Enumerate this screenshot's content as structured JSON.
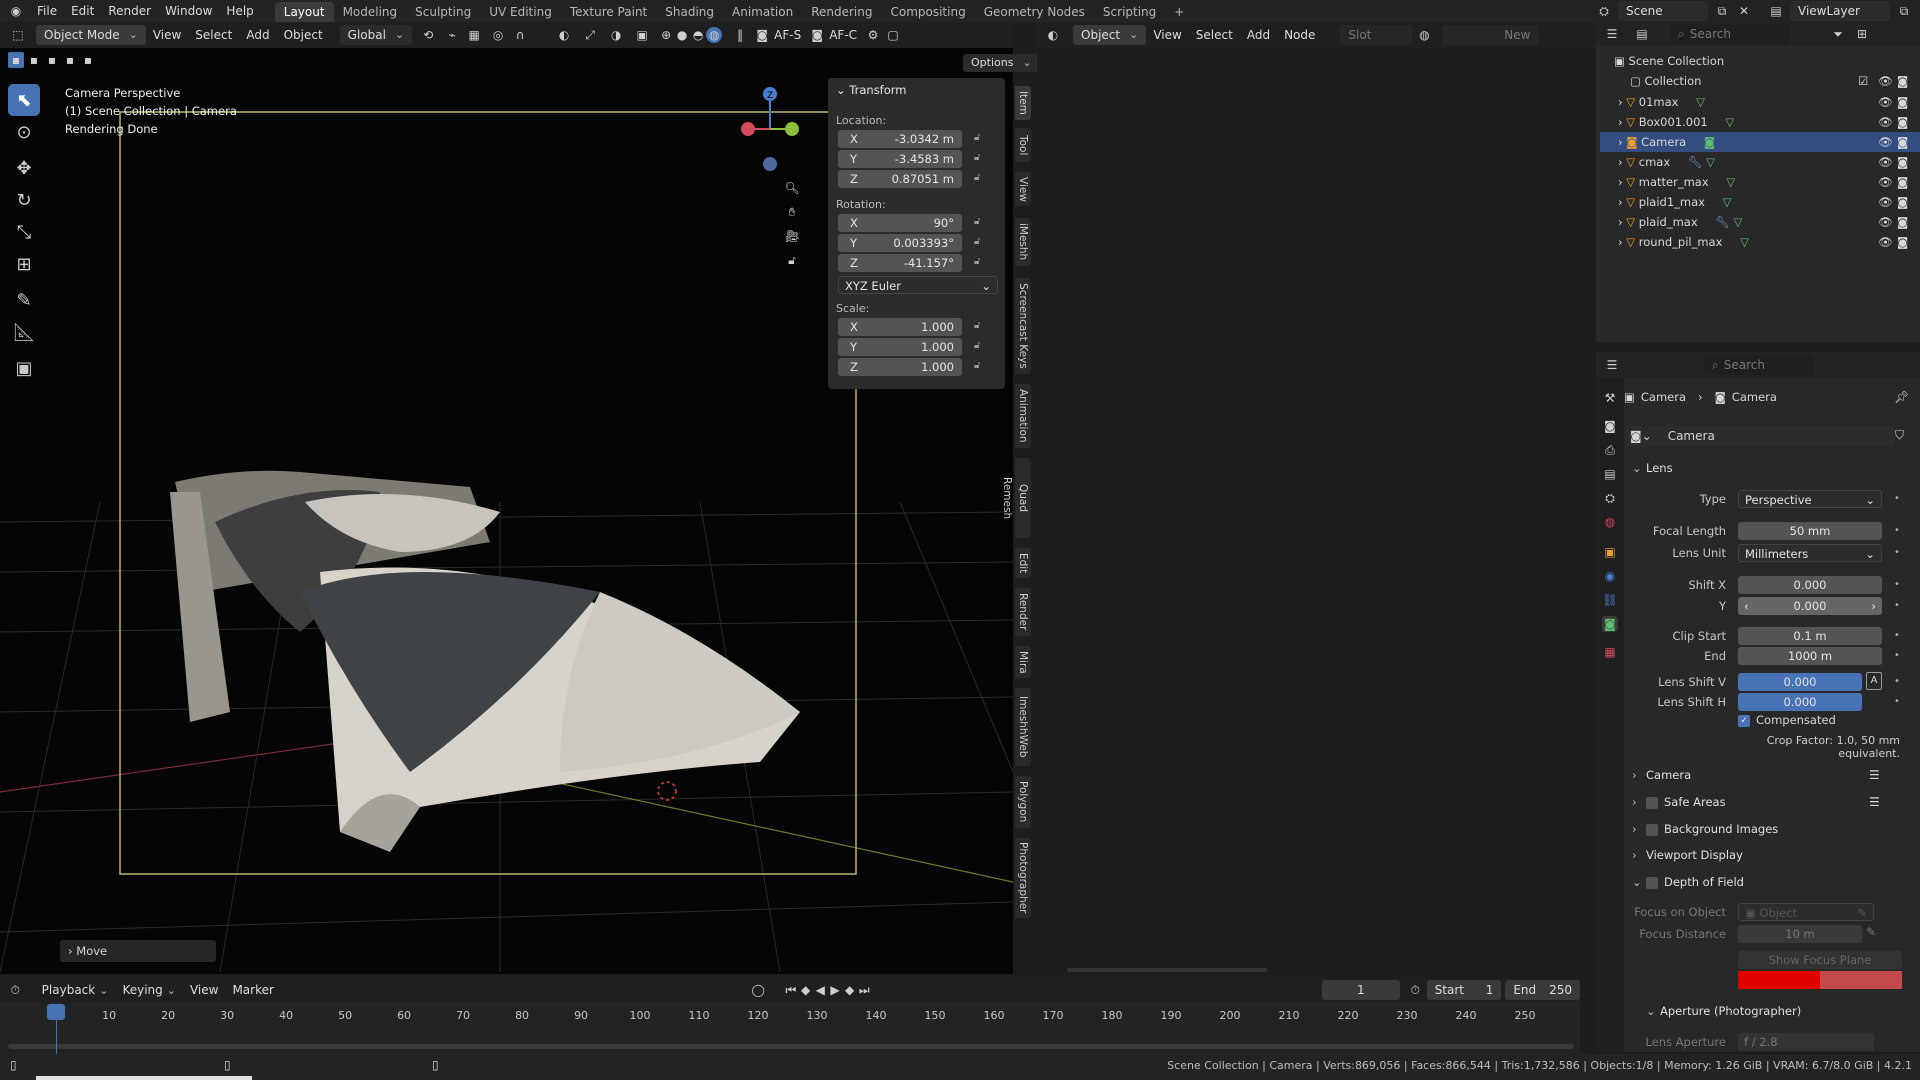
{
  "topbar": {
    "menus": [
      "File",
      "Edit",
      "Render",
      "Window",
      "Help"
    ],
    "workspaces": [
      "Layout",
      "Modeling",
      "Sculpting",
      "UV Editing",
      "Texture Paint",
      "Shading",
      "Animation",
      "Rendering",
      "Compositing",
      "Geometry Nodes",
      "Scripting"
    ],
    "active_workspace": "Layout",
    "scene": "Scene",
    "view_layer": "ViewLayer"
  },
  "viewport_header": {
    "mode": "Object Mode",
    "menus": [
      "View",
      "Select",
      "Add",
      "Object"
    ],
    "orientation": "Global",
    "af_s": "AF-S",
    "af_c": "AF-C",
    "options": "Options"
  },
  "viewport": {
    "title": "Camera Perspective",
    "collection": "(1) Scene Collection | Camera",
    "status": "Rendering Done",
    "last_op": "Move",
    "gizmo": {
      "z": "Z"
    }
  },
  "transform_panel": {
    "title": "Transform",
    "location_label": "Location:",
    "location": [
      {
        "axis": "X",
        "value": "-3.0342 m"
      },
      {
        "axis": "Y",
        "value": "-3.4583 m"
      },
      {
        "axis": "Z",
        "value": "0.87051 m"
      }
    ],
    "rotation_label": "Rotation:",
    "rotation": [
      {
        "axis": "X",
        "value": "90°"
      },
      {
        "axis": "Y",
        "value": "0.003393°"
      },
      {
        "axis": "Z",
        "value": "-41.157°"
      }
    ],
    "rotation_mode": "XYZ Euler",
    "scale_label": "Scale:",
    "scale": [
      {
        "axis": "X",
        "value": "1.000"
      },
      {
        "axis": "Y",
        "value": "1.000"
      },
      {
        "axis": "Z",
        "value": "1.000"
      }
    ]
  },
  "sidebar_tabs": [
    "Item",
    "Tool",
    "View",
    "iMeshh",
    "Screencast Keys",
    "Animation",
    "Quad Remesh",
    "Edit",
    "Render",
    "Mira",
    "ImeshhWeb",
    "Polygon",
    "Photographer"
  ],
  "node_header": {
    "object": "Object",
    "menus": [
      "View",
      "Select",
      "Add",
      "Node"
    ],
    "slot": "Slot",
    "new": "New"
  },
  "outliner": {
    "search_placeholder": "Search",
    "root": "Scene Collection",
    "collection": "Collection",
    "items": [
      "01max",
      "Box001.001",
      "Camera",
      "cmax",
      "matter_max",
      "plaid1_max",
      "plaid_max",
      "round_pil_max"
    ],
    "selected": "Camera"
  },
  "properties": {
    "search_placeholder": "Search",
    "breadcrumb": [
      "Camera",
      "Camera"
    ],
    "datablock": "Camera",
    "lens_title": "Lens",
    "type_label": "Type",
    "type_value": "Perspective",
    "focal_label": "Focal Length",
    "focal_value": "50 mm",
    "lens_unit_label": "Lens Unit",
    "lens_unit_value": "Millimeters",
    "shift_x_label": "Shift X",
    "shift_x_value": "0.000",
    "shift_y_label": "Y",
    "shift_y_value": "0.000",
    "clip_start_label": "Clip Start",
    "clip_start_value": "0.1 m",
    "clip_end_label": "End",
    "clip_end_value": "1000 m",
    "lens_shift_v_label": "Lens Shift V",
    "lens_shift_v_value": "0.000",
    "lens_shift_h_label": "Lens Shift H",
    "lens_shift_h_value": "0.000",
    "compensated": "Compensated",
    "crop_factor": "Crop Factor: 1.0, 50 mm equivalent.",
    "sections": [
      "Camera",
      "Safe Areas",
      "Background Images",
      "Viewport Display",
      "Depth of Field"
    ],
    "focus_object_label": "Focus on Object",
    "focus_object_placeholder": "Object",
    "focus_distance_label": "Focus Distance",
    "focus_distance_value": "10 m",
    "show_focus_plane": "Show Focus Plane",
    "aperture_title": "Aperture (Photographer)",
    "lens_aperture_label": "Lens Aperture Pr...",
    "lens_aperture_value": "f / 2.8"
  },
  "timeline": {
    "menus": [
      "Playback",
      "Keying",
      "View",
      "Marker"
    ],
    "current_frame": "1",
    "start_label": "Start",
    "start_value": "1",
    "end_label": "End",
    "end_value": "250",
    "ticks": [
      "1",
      "10",
      "20",
      "30",
      "40",
      "50",
      "60",
      "70",
      "80",
      "90",
      "100",
      "110",
      "120",
      "130",
      "140",
      "150",
      "160",
      "170",
      "180",
      "190",
      "200",
      "210",
      "220",
      "230",
      "240",
      "250"
    ]
  },
  "statusbar": {
    "text": "Scene Collection | Camera | Verts:869,056 | Faces:866,544 | Tris:1,732,586 | Objects:1/8 | Memory: 1.26 GiB | VRAM: 6.7/8.0 GiB | 4.2.1"
  },
  "colors": {
    "accent": "#4772b3",
    "camera_frame": "#c7c07a",
    "red": "#e00000"
  }
}
